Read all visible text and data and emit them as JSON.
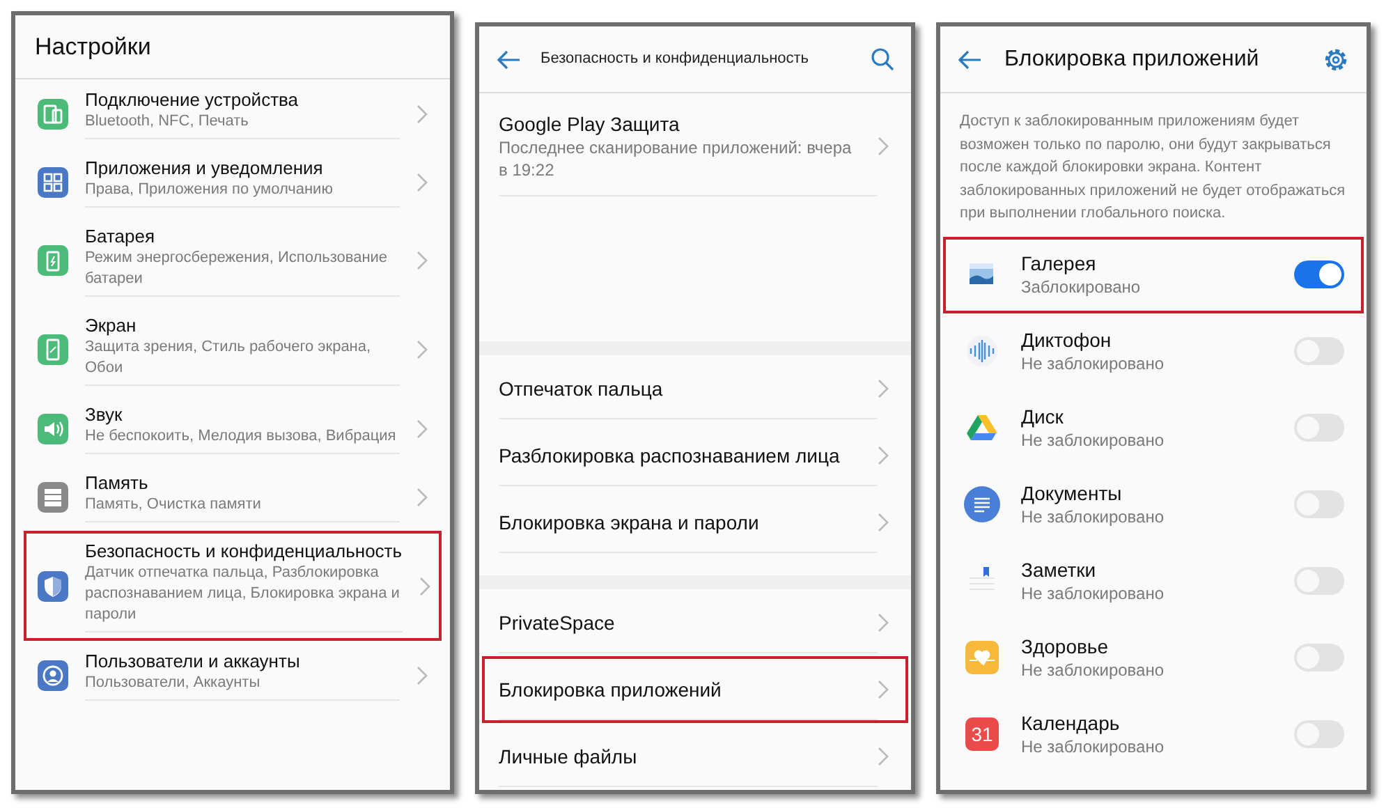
{
  "settings_screen": {
    "title": "Настройки",
    "items": [
      {
        "title": "Подключение устройства",
        "subtitle": "Bluetooth, NFC, Печать",
        "highlighted": false
      },
      {
        "title": "Приложения и уведомления",
        "subtitle": "Права, Приложения по умолчанию",
        "highlighted": false
      },
      {
        "title": "Батарея",
        "subtitle": "Режим энергосбережения, Использование батареи",
        "highlighted": false
      },
      {
        "title": "Экран",
        "subtitle": "Защита зрения, Стиль рабочего экрана, Обои",
        "highlighted": false
      },
      {
        "title": "Звук",
        "subtitle": "Не беспокоить, Мелодия вызова, Вибрация",
        "highlighted": false
      },
      {
        "title": "Память",
        "subtitle": "Память, Очистка памяти",
        "highlighted": false
      },
      {
        "title": "Безопасность и конфиденциальность",
        "subtitle": "Датчик отпечатка пальца, Разблокировка распознаванием лица, Блокировка экрана и пароли",
        "highlighted": true
      },
      {
        "title": "Пользователи и аккаунты",
        "subtitle": "Пользователи, Аккаунты",
        "highlighted": false
      }
    ]
  },
  "security_screen": {
    "title": "Безопасность и конфиденциальность",
    "groups": [
      [
        {
          "title": "Google Play Защита",
          "subtitle": "Последнее сканирование приложений: вчера в 19:22",
          "highlighted": false
        }
      ],
      [
        {
          "title": "Отпечаток пальца",
          "highlighted": false
        },
        {
          "title": "Разблокировка распознаванием лица",
          "highlighted": false
        },
        {
          "title": "Блокировка экрана и пароли",
          "highlighted": false
        }
      ],
      [
        {
          "title": "PrivateSpace",
          "highlighted": false
        },
        {
          "title": "Блокировка приложений",
          "highlighted": true
        },
        {
          "title": "Личные файлы",
          "highlighted": false
        }
      ]
    ]
  },
  "app_lock_screen": {
    "title": "Блокировка приложений",
    "description": "Доступ к заблокированным приложениям будет возможен только по паролю, они будут закрываться после каждой блокировки экрана. Контент заблокированных приложений не будет отображаться при выполнении глобального поиска.",
    "apps": [
      {
        "title": "Галерея",
        "status": "Заблокировано",
        "on": true,
        "highlighted": true
      },
      {
        "title": "Диктофон",
        "status": "Не заблокировано",
        "on": false,
        "highlighted": false
      },
      {
        "title": "Диск",
        "status": "Не заблокировано",
        "on": false,
        "highlighted": false
      },
      {
        "title": "Документы",
        "status": "Не заблокировано",
        "on": false,
        "highlighted": false
      },
      {
        "title": "Заметки",
        "status": "Не заблокировано",
        "on": false,
        "highlighted": false
      },
      {
        "title": "Здоровье",
        "status": "Не заблокировано",
        "on": false,
        "highlighted": false
      },
      {
        "title": "Календарь",
        "status": "Не заблокировано",
        "on": false,
        "highlighted": false,
        "icon_text": "31"
      }
    ]
  }
}
